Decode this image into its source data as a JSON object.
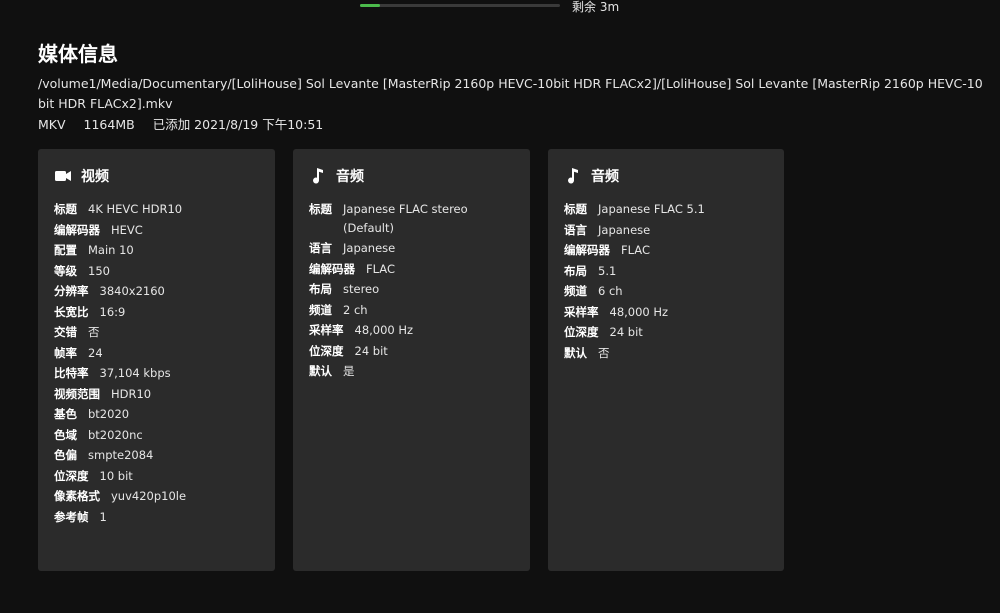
{
  "progress": {
    "remaining": "剩余 3m",
    "percent": 10
  },
  "info": {
    "title": "媒体信息",
    "path": "/volume1/Media/Documentary/[LoliHouse] Sol Levante [MasterRip 2160p HEVC-10bit HDR FLACx2]/[LoliHouse] Sol Levante [MasterRip 2160p HEVC-10bit HDR FLACx2].mkv",
    "container": "MKV",
    "size": "1164MB",
    "added": "已添加 2021/8/19 下午10:51"
  },
  "cards": [
    {
      "title": "视频",
      "icon": "video-camera-icon",
      "rows": [
        {
          "k": "标题",
          "v": "4K HEVC HDR10"
        },
        {
          "k": "编解码器",
          "v": "HEVC"
        },
        {
          "k": "配置",
          "v": "Main 10"
        },
        {
          "k": "等级",
          "v": "150"
        },
        {
          "k": "分辨率",
          "v": "3840x2160"
        },
        {
          "k": "长宽比",
          "v": "16:9"
        },
        {
          "k": "交错",
          "v": "否"
        },
        {
          "k": "帧率",
          "v": "24"
        },
        {
          "k": "比特率",
          "v": "37,104 kbps"
        },
        {
          "k": "视频范围",
          "v": "HDR10"
        },
        {
          "k": "基色",
          "v": "bt2020"
        },
        {
          "k": "色域",
          "v": "bt2020nc"
        },
        {
          "k": "色偏",
          "v": "smpte2084"
        },
        {
          "k": "位深度",
          "v": "10 bit"
        },
        {
          "k": "像素格式",
          "v": "yuv420p10le"
        },
        {
          "k": "参考帧",
          "v": "1"
        }
      ]
    },
    {
      "title": "音频",
      "icon": "music-note-icon",
      "rows": [
        {
          "k": "标题",
          "v": "Japanese FLAC stereo (Default)"
        },
        {
          "k": "语言",
          "v": "Japanese"
        },
        {
          "k": "编解码器",
          "v": "FLAC"
        },
        {
          "k": "布局",
          "v": "stereo"
        },
        {
          "k": "频道",
          "v": "2 ch"
        },
        {
          "k": "采样率",
          "v": "48,000 Hz"
        },
        {
          "k": "位深度",
          "v": "24 bit"
        },
        {
          "k": "默认",
          "v": "是"
        }
      ]
    },
    {
      "title": "音频",
      "icon": "music-note-icon",
      "rows": [
        {
          "k": "标题",
          "v": "Japanese FLAC 5.1"
        },
        {
          "k": "语言",
          "v": "Japanese"
        },
        {
          "k": "编解码器",
          "v": "FLAC"
        },
        {
          "k": "布局",
          "v": "5.1"
        },
        {
          "k": "频道",
          "v": "6 ch"
        },
        {
          "k": "采样率",
          "v": "48,000 Hz"
        },
        {
          "k": "位深度",
          "v": "24 bit"
        },
        {
          "k": "默认",
          "v": "否"
        }
      ]
    }
  ]
}
